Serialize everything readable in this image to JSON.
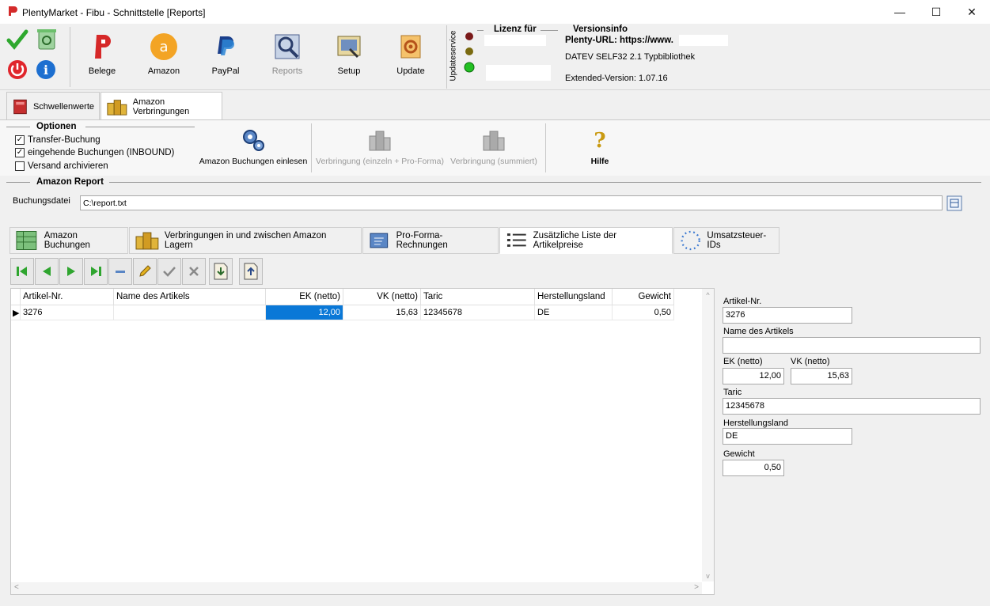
{
  "window": {
    "title": "PlentyMarket - Fibu - Schnittstelle [Reports]",
    "minimize": "—",
    "maximize": "☐",
    "close": "✕"
  },
  "toolbar": {
    "buttons": [
      {
        "label": "Belege",
        "icon": "belege-icon"
      },
      {
        "label": "Amazon",
        "icon": "amazon-icon"
      },
      {
        "label": "PayPal",
        "icon": "paypal-icon"
      },
      {
        "label": "Reports",
        "icon": "reports-icon",
        "disabled": true
      },
      {
        "label": "Setup",
        "icon": "setup-icon"
      },
      {
        "label": "Update",
        "icon": "update-icon"
      }
    ],
    "updateservice_label": "Updateservice",
    "lizenz_title": "Lizenz für",
    "versionsinfo_title": "Versionsinfo",
    "plenty_url": "Plenty-URL: https://www.",
    "datev": "DATEV SELF32 2.1 Typbibliothek",
    "extended_version": "Extended-Version: 1.07.16",
    "status_colors": [
      "#7a1a1a",
      "#7a6a10",
      "#22c022"
    ]
  },
  "top_tabs": [
    {
      "label": "Schwellenwerte",
      "active": false
    },
    {
      "label": "Amazon Verbringungen",
      "active": true
    }
  ],
  "optionen": {
    "title": "Optionen",
    "items": [
      {
        "label": "Transfer-Buchung",
        "checked": true
      },
      {
        "label": "eingehende Buchungen (INBOUND)",
        "checked": true
      },
      {
        "label": "Versand archivieren",
        "checked": false
      }
    ]
  },
  "actions": {
    "einlesen": "Amazon Buchungen einlesen",
    "verbringung_einzeln": "Verbringung (einzeln + Pro-Forma)",
    "verbringung_summiert": "Verbringung (summiert)",
    "hilfe": "Hilfe"
  },
  "report": {
    "title": "Amazon Report",
    "buchungsdatei_label": "Buchungsdatei",
    "buchungsdatei_value": "C:\\report.txt"
  },
  "inner_tabs": [
    {
      "label": "Amazon Buchungen",
      "active": false
    },
    {
      "label": "Verbringungen in und zwischen Amazon Lagern",
      "active": false
    },
    {
      "label": "Pro-Forma-Rechnungen",
      "active": false
    },
    {
      "label": "Zusätzliche Liste der Artikelpreise",
      "active": true
    },
    {
      "label": "Umsatzsteuer-IDs",
      "active": false
    }
  ],
  "nav": {
    "first": "first-record-icon",
    "prev": "prev-record-icon",
    "next": "next-record-icon",
    "last": "last-record-icon",
    "delete": "delete-record-icon",
    "edit": "edit-record-icon",
    "post": "post-record-icon",
    "cancel": "cancel-record-icon",
    "import": "import-icon",
    "export": "export-icon"
  },
  "grid": {
    "columns": [
      "Artikel-Nr.",
      "Name des Artikels",
      "EK (netto)",
      "VK (netto)",
      "Taric",
      "Herstellungsland",
      "Gewicht"
    ],
    "rows": [
      {
        "artikel_nr": "3276",
        "name": "",
        "ek": "12,00",
        "vk": "15,63",
        "taric": "12345678",
        "land": "DE",
        "gewicht": "0,50"
      }
    ]
  },
  "detail": {
    "artikel_nr_label": "Artikel-Nr.",
    "artikel_nr": "3276",
    "name_label": "Name des Artikels",
    "name": "",
    "ek_label": "EK (netto)",
    "ek": "12,00",
    "vk_label": "VK (netto)",
    "vk": "15,63",
    "taric_label": "Taric",
    "taric": "12345678",
    "land_label": "Herstellungsland",
    "land": "DE",
    "gewicht_label": "Gewicht",
    "gewicht": "0,50"
  }
}
